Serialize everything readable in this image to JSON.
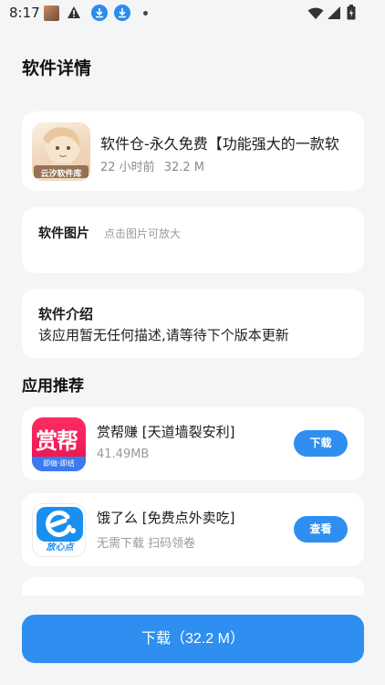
{
  "status_bar": {
    "time": "8:17",
    "icons": [
      "avatar-icon",
      "warning-icon",
      "download-icon",
      "download-icon",
      "dot-icon",
      "wifi-icon",
      "signal-icon",
      "battery-icon"
    ]
  },
  "page": {
    "title": "软件详情"
  },
  "app": {
    "name": "软件仓-永久免费【功能强大的一款软",
    "time_ago": "22 小时前",
    "size": "32.2 M",
    "icon_caption": "云汐软件库"
  },
  "images_section": {
    "title": "软件图片",
    "hint": "点击图片可放大"
  },
  "intro_section": {
    "title": "软件介绍",
    "description": "该应用暂无任何描述,请等待下个版本更新"
  },
  "recommend": {
    "title": "应用推荐",
    "items": [
      {
        "name": "赏帮赚 [天道墙裂安利]",
        "sub": "41.49MB",
        "button": "下载",
        "icon_text": "赏帮",
        "icon_banner": "即做·即结"
      },
      {
        "name": "饿了么 [免费点外卖吃]",
        "sub": "无需下载 扫码领卷",
        "button": "查看",
        "icon_text": "饿了么",
        "icon_banner": "放心点"
      }
    ]
  },
  "download_button": {
    "label": "下载（32.2 M）"
  },
  "colors": {
    "accent": "#2e8ff0",
    "background": "#f4f5f7",
    "card": "#ffffff"
  }
}
